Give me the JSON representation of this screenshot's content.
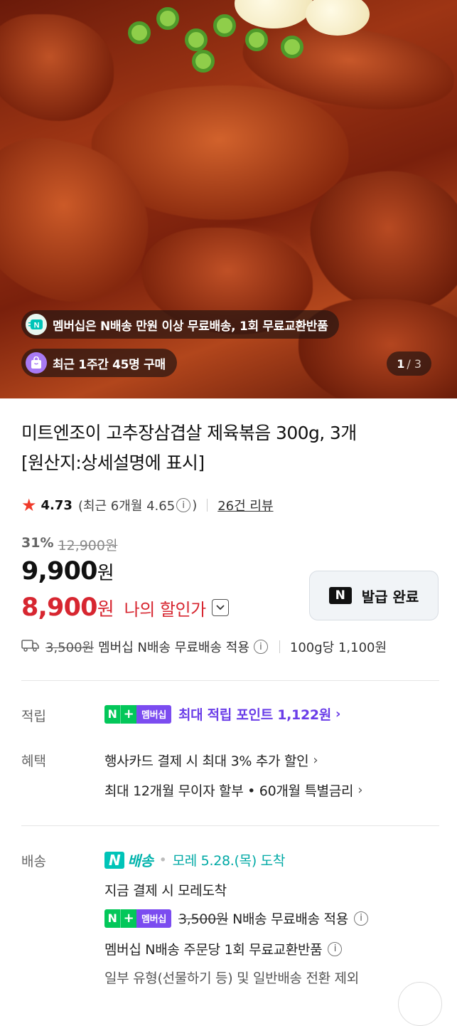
{
  "hero": {
    "membership_badge": "멤버십은 N배송 만원 이상 무료배송, 1회 무료교환반품",
    "purchase_badge": "최근 1주간 45명 구매",
    "page_current": "1",
    "page_total": "/ 3"
  },
  "product": {
    "title_line1": "미트엔조이 고추장삼겹살 제육볶음 300g, 3개",
    "title_line2": "[원산지:상세설명에 표시]",
    "rating": "4.73",
    "recent_rating_prefix": "(최근 6개월 4.65",
    "recent_rating_suffix": ")",
    "review_link": "26건 리뷰",
    "discount_pct": "31%",
    "original_price": "12,900원",
    "price": "9,900",
    "price_unit": "원",
    "my_price": "8,900",
    "my_price_unit": "원",
    "my_price_label": "나의 할인가",
    "coupon_button": "발급 완료",
    "coupon_icon": "N",
    "shipping_orig": "3,500원",
    "shipping_text": "멤버십 N배송 무료배송 적용",
    "unit_price": "100g당 1,100원"
  },
  "points": {
    "label": "적립",
    "badge_n": "N",
    "badge_plus": "+",
    "badge_member": "멤버십",
    "text": "최대 적립 포인트 1,122원"
  },
  "benefits": {
    "label": "혜택",
    "line1": "행사카드 결제 시 최대 3% 추가 할인",
    "line2": "최대 12개월 무이자 할부 • 60개월 특별금리"
  },
  "delivery": {
    "label": "배송",
    "nb_icon": "N",
    "nb_label": "배송",
    "dot": "•",
    "eta": "모레 5.28.(목) 도착",
    "line2": "지금 결제 시 모레도착",
    "orig_fee": "3,500원",
    "line3": "N배송 무료배송 적용",
    "line4": "멤버십 N배송 주문당 1회 무료교환반품",
    "line5": "일부 유형(선물하기 등) 및 일반배송 전환 제외"
  },
  "icons": {
    "info": "ⓘ"
  }
}
